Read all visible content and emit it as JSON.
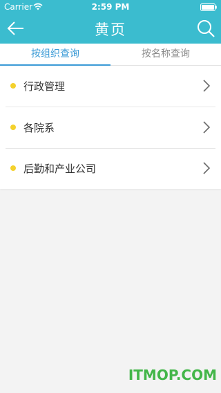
{
  "status_bar": {
    "carrier": "Carrier",
    "time": "2:59 PM"
  },
  "header": {
    "title": "黄页",
    "back_icon": "back-arrow-icon",
    "search_icon": "search-icon"
  },
  "tabs": [
    {
      "label": "按组织查询",
      "active": true
    },
    {
      "label": "按名称查询",
      "active": false
    }
  ],
  "list": {
    "items": [
      {
        "label": "行政管理"
      },
      {
        "label": "各院系"
      },
      {
        "label": "后勤和产业公司"
      }
    ]
  },
  "watermark": "ITMOP.COM",
  "colors": {
    "header_bg": "#3bbccf",
    "active_tab": "#3a9ad6",
    "dot": "#f4d12c",
    "watermark": "#43b649"
  }
}
